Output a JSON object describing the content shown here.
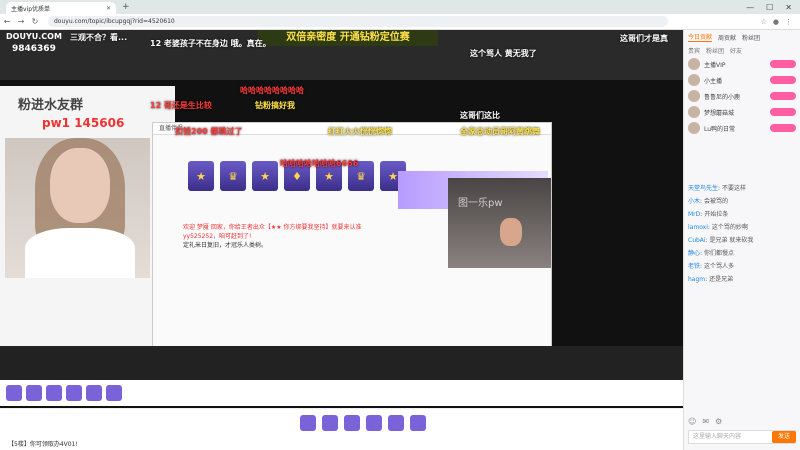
{
  "browser": {
    "tab_title": "主播vip优质单",
    "url": "douyu.com/topic/ibcupgqj?rid=4520610"
  },
  "stream": {
    "logo": "DOUYU.COM",
    "score": "9846369",
    "banner": "双倍亲密度 开通钻粉定位赛",
    "rank_text": "粉进水友群",
    "face_id": "pw1 145606",
    "guest_label": "图一乐pw",
    "screen_header": "直播伴侣",
    "chat_lines": [
      "欢迎 梦魇 回家，你给王者出众【★★ 你方绑要我坚持】就要来认准yy525252，咱可赶到了!",
      "定礼米日复旧，才冠乐人类树。"
    ],
    "danmu": [
      {
        "text": "三观不合？看...",
        "color": "#ffffff"
      },
      {
        "text": "12 老婆孩子不在身边 哦。真在。",
        "color": "#ffffff"
      },
      {
        "text": "这个骂人 黄无我了",
        "color": "#ffffff"
      },
      {
        "text": "这哥们才是真",
        "color": "#ffffff"
      },
      {
        "text": "哈哈哈哈哈哈哈哈",
        "color": "#ff3b3b"
      },
      {
        "text": "12 哥还是生比较",
        "color": "#ff3b3b"
      },
      {
        "text": "钻粉搞好我",
        "color": "#ffe24a"
      },
      {
        "text": "扣钱200 都跳过了",
        "color": "#ff3b3b"
      },
      {
        "text": "红红火火恍恍惚惚",
        "color": "#ffe24a"
      },
      {
        "text": "全家总动员哥阿黄跳舞",
        "color": "#ffe24a"
      },
      {
        "text": "哈哈哈哈哈哈哈6666",
        "color": "#ff3b3b"
      },
      {
        "text": "这哥们这比",
        "color": "#ffffff"
      }
    ],
    "bottom_line": "【5楼】你可领取办4V01!"
  },
  "sidebar": {
    "tabs": [
      "今日贡献",
      "周贡献",
      "粉丝团"
    ],
    "active_tab": "今日贡献",
    "sub_tabs": [
      "贵宾",
      "粉丝团",
      "好友"
    ],
    "users": [
      "主播VIP",
      "小主播",
      "鲁鲁尼的小鹿",
      "梦想蘑菇城",
      "Lu鸭的日常"
    ],
    "chat": [
      {
        "name": "天堂鸟先生",
        "text": "不要这样"
      },
      {
        "name": "小木",
        "text": "会被骂的"
      },
      {
        "name": "MrD",
        "text": "开始拉条"
      },
      {
        "name": "lamoxi",
        "text": "这个骂的妙啊"
      },
      {
        "name": "CubAi",
        "text": "是兄弟 就来砍我"
      },
      {
        "name": "静心",
        "text": "你们都慢点"
      },
      {
        "name": "老铁",
        "text": "这个骂人多"
      },
      {
        "name": "hagm",
        "text": "还是兄弟"
      }
    ],
    "input_placeholder": "这里输入聊天内容",
    "send_label": "发送"
  }
}
